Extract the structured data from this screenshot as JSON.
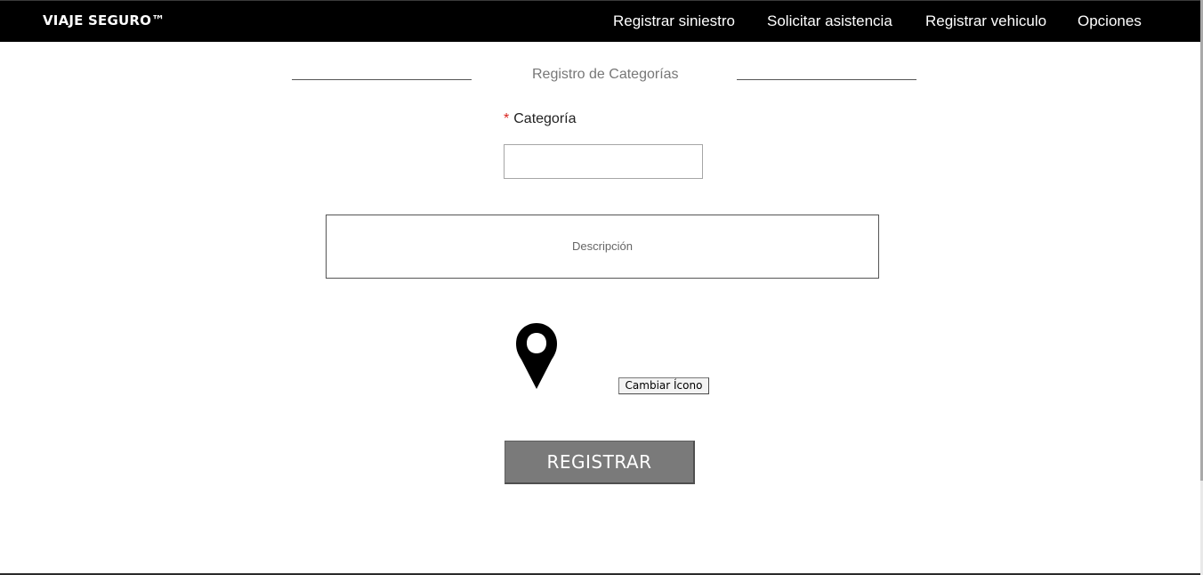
{
  "navbar": {
    "brand": "VIAJE SEGURO™",
    "items": [
      {
        "label": "Registrar siniestro"
      },
      {
        "label": "Solicitar asistencia"
      },
      {
        "label": "Registrar vehiculo"
      },
      {
        "label": "Opciones"
      }
    ]
  },
  "form": {
    "section_title": "Registro de Categorías",
    "category_label": "Categoría",
    "required_marker": "*",
    "category_value": "",
    "description_placeholder": "Descripción",
    "icon": "map-pin-icon",
    "change_icon_label": "Cambiar Ícono",
    "submit_label": "REGISTRAR"
  },
  "colors": {
    "navbar_bg": "#000000",
    "required": "#d9231d",
    "button_bg": "#7a7a7a"
  }
}
